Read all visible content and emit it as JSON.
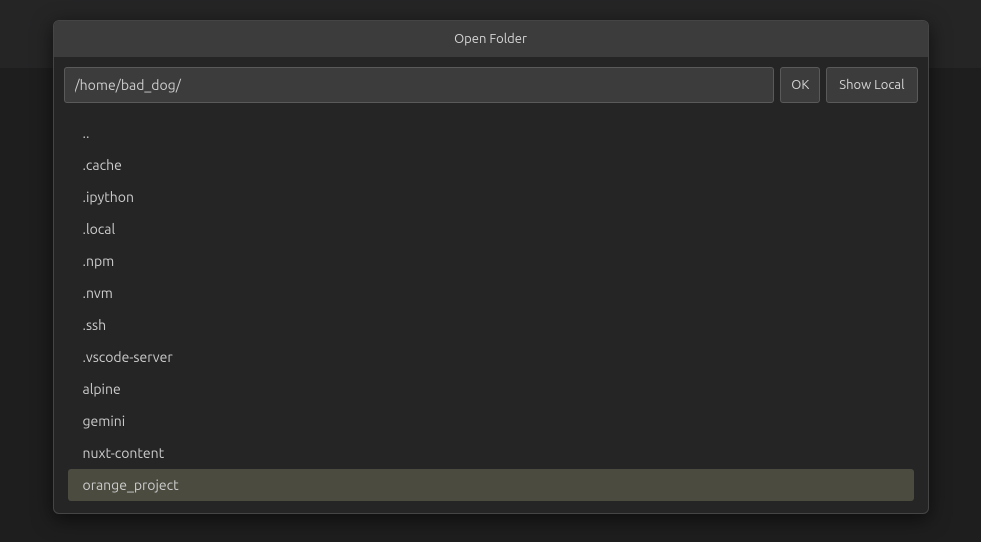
{
  "dialog": {
    "title": "Open Folder",
    "path_input_value": "/home/bad_dog/",
    "buttons": {
      "ok_label": "OK",
      "show_local_label": "Show Local"
    },
    "entries": [
      {
        "name": "..",
        "highlighted": false
      },
      {
        "name": ".cache",
        "highlighted": false
      },
      {
        "name": ".ipython",
        "highlighted": false
      },
      {
        "name": ".local",
        "highlighted": false
      },
      {
        "name": ".npm",
        "highlighted": false
      },
      {
        "name": ".nvm",
        "highlighted": false
      },
      {
        "name": ".ssh",
        "highlighted": false
      },
      {
        "name": ".vscode-server",
        "highlighted": false
      },
      {
        "name": "alpine",
        "highlighted": false
      },
      {
        "name": "gemini",
        "highlighted": false
      },
      {
        "name": "nuxt-content",
        "highlighted": false
      },
      {
        "name": "orange_project",
        "highlighted": true
      }
    ]
  }
}
